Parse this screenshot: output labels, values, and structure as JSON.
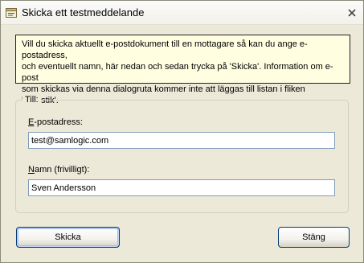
{
  "window": {
    "title": "Skicka ett testmeddelande",
    "icons": {
      "app": "dialog-app-icon",
      "close": "close-icon"
    }
  },
  "info": {
    "line1": "Vill du skicka aktuellt e-postdokument till en mottagare så kan du ange e-postadress,",
    "line2": "och eventuellt namn, här nedan och sedan trycka på 'Skicka'. Information om e-post",
    "line3": "som skickas via denna dialogruta kommer inte att läggas till listan i fliken 'Statistik'."
  },
  "group": {
    "legend": "Till:",
    "email": {
      "label_mnemonic": "E",
      "label_rest": "-postadress:",
      "value": "test@samlogic.com"
    },
    "name": {
      "label_mnemonic": "N",
      "label_rest": "amn (frivilligt):",
      "value": "Sven Andersson"
    }
  },
  "buttons": {
    "send": "Skicka",
    "close": "Stäng"
  },
  "colors": {
    "dialog_bg": "#ece9d8",
    "info_bg": "#fffee1",
    "input_border": "#7f9db9",
    "button_border": "#003c74"
  }
}
